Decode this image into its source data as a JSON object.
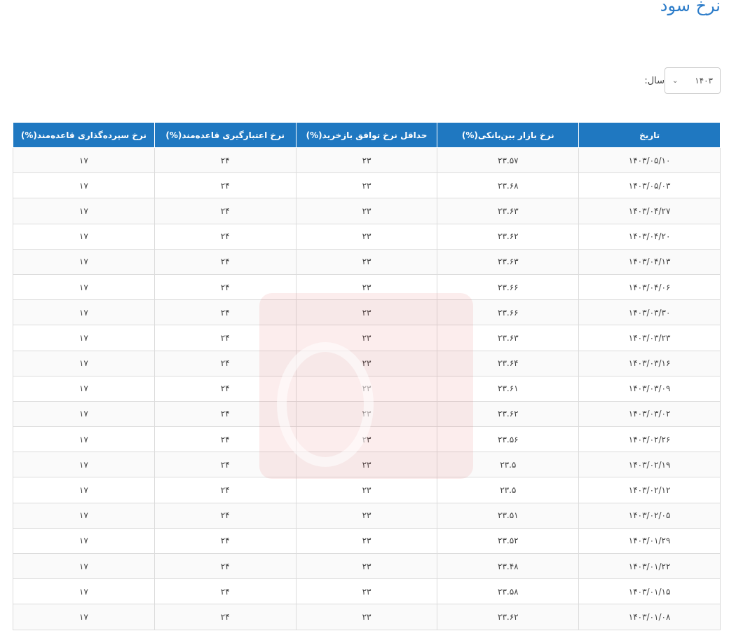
{
  "page": {
    "title": "نرخ سود"
  },
  "filter": {
    "year_label": "سال:",
    "year_value": "۱۴۰۳",
    "chevron_icon": "chevron-down-icon"
  },
  "table": {
    "headers": [
      "تاریخ",
      "نرخ بازار بین‌بانکی(%)",
      "حداقل نرخ توافق بازخرید(%)",
      "نرخ اعتبارگیری قاعده‌مند(%)",
      "نرخ سپرده‌گذاری قاعده‌مند(%)"
    ],
    "rows": [
      [
        "۱۴۰۳/۰۵/۱۰",
        "۲۳.۵۷",
        "۲۳",
        "۲۴",
        "۱۷"
      ],
      [
        "۱۴۰۳/۰۵/۰۳",
        "۲۳.۶۸",
        "۲۳",
        "۲۴",
        "۱۷"
      ],
      [
        "۱۴۰۳/۰۴/۲۷",
        "۲۳.۶۳",
        "۲۳",
        "۲۴",
        "۱۷"
      ],
      [
        "۱۴۰۳/۰۴/۲۰",
        "۲۳.۶۲",
        "۲۳",
        "۲۴",
        "۱۷"
      ],
      [
        "۱۴۰۳/۰۴/۱۳",
        "۲۳.۶۳",
        "۲۳",
        "۲۴",
        "۱۷"
      ],
      [
        "۱۴۰۳/۰۴/۰۶",
        "۲۳.۶۶",
        "۲۳",
        "۲۴",
        "۱۷"
      ],
      [
        "۱۴۰۳/۰۳/۳۰",
        "۲۳.۶۶",
        "۲۳",
        "۲۴",
        "۱۷"
      ],
      [
        "۱۴۰۳/۰۳/۲۳",
        "۲۳.۶۳",
        "۲۳",
        "۲۴",
        "۱۷"
      ],
      [
        "۱۴۰۳/۰۳/۱۶",
        "۲۳.۶۴",
        "۲۳",
        "۲۴",
        "۱۷"
      ],
      [
        "۱۴۰۳/۰۳/۰۹",
        "۲۳.۶۱",
        "۲۳",
        "۲۴",
        "۱۷"
      ],
      [
        "۱۴۰۳/۰۳/۰۲",
        "۲۳.۶۲",
        "۲۳",
        "۲۴",
        "۱۷"
      ],
      [
        "۱۴۰۳/۰۲/۲۶",
        "۲۳.۵۶",
        "۲۳",
        "۲۴",
        "۱۷"
      ],
      [
        "۱۴۰۳/۰۲/۱۹",
        "۲۳.۵",
        "۲۳",
        "۲۴",
        "۱۷"
      ],
      [
        "۱۴۰۳/۰۲/۱۲",
        "۲۳.۵",
        "۲۳",
        "۲۴",
        "۱۷"
      ],
      [
        "۱۴۰۳/۰۲/۰۵",
        "۲۳.۵۱",
        "۲۳",
        "۲۴",
        "۱۷"
      ],
      [
        "۱۴۰۳/۰۱/۲۹",
        "۲۳.۵۲",
        "۲۳",
        "۲۴",
        "۱۷"
      ],
      [
        "۱۴۰۳/۰۱/۲۲",
        "۲۳.۴۸",
        "۲۳",
        "۲۴",
        "۱۷"
      ],
      [
        "۱۴۰۳/۰۱/۱۵",
        "۲۳.۵۸",
        "۲۳",
        "۲۴",
        "۱۷"
      ],
      [
        "۱۴۰۳/۰۱/۰۸",
        "۲۳.۶۲",
        "۲۳",
        "۲۴",
        "۱۷"
      ]
    ]
  },
  "colors": {
    "header_bg": "#1f78c1",
    "title": "#2c7cc9"
  }
}
